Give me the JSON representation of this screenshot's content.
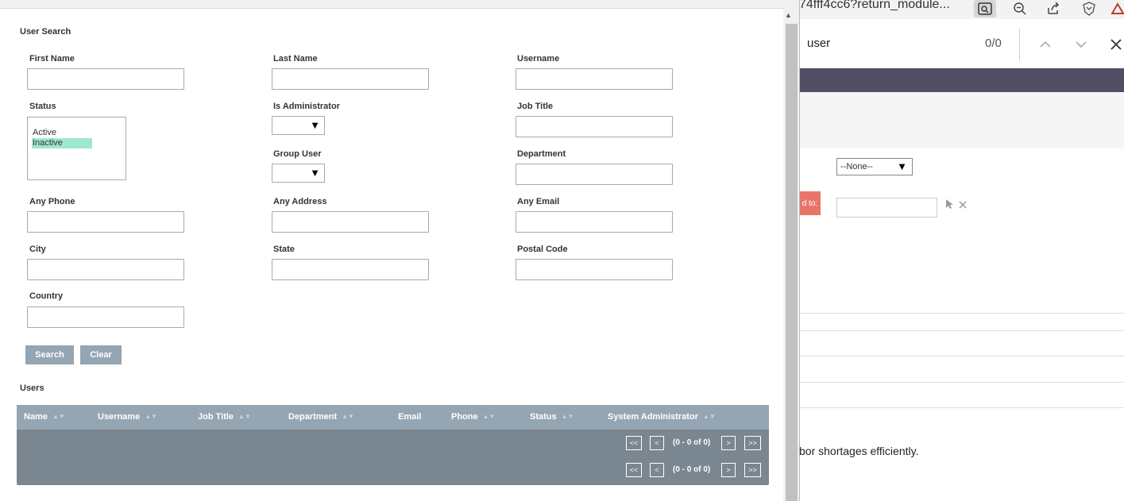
{
  "browser": {
    "url_fragment": "74fff4cc6?return_module...",
    "find": {
      "query": "user",
      "count": "0/0"
    },
    "bg_select_value": "--None--",
    "bg_assigned_label": "d to:",
    "bg_text": "bor shortages efficiently."
  },
  "modal": {
    "search_section": "User Search",
    "fields": {
      "first_name": "First Name",
      "last_name": "Last Name",
      "username": "Username",
      "status": "Status",
      "is_admin": "Is Administrator",
      "job_title": "Job Title",
      "group_user": "Group User",
      "department": "Department",
      "any_phone": "Any Phone",
      "any_address": "Any Address",
      "any_email": "Any Email",
      "city": "City",
      "state": "State",
      "postal_code": "Postal Code",
      "country": "Country"
    },
    "status_options": [
      "Active",
      "Inactive"
    ],
    "status_selected": "Inactive",
    "buttons": {
      "search": "Search",
      "clear": "Clear"
    },
    "users_section": "Users",
    "table": {
      "columns": [
        "Name",
        "Username",
        "Job Title",
        "Department",
        "Email",
        "Phone",
        "Status",
        "System Administrator"
      ],
      "pager": {
        "first": "<<",
        "prev": "<",
        "info": "(0 - 0 of 0)",
        "next": ">",
        "last": ">>"
      }
    }
  }
}
